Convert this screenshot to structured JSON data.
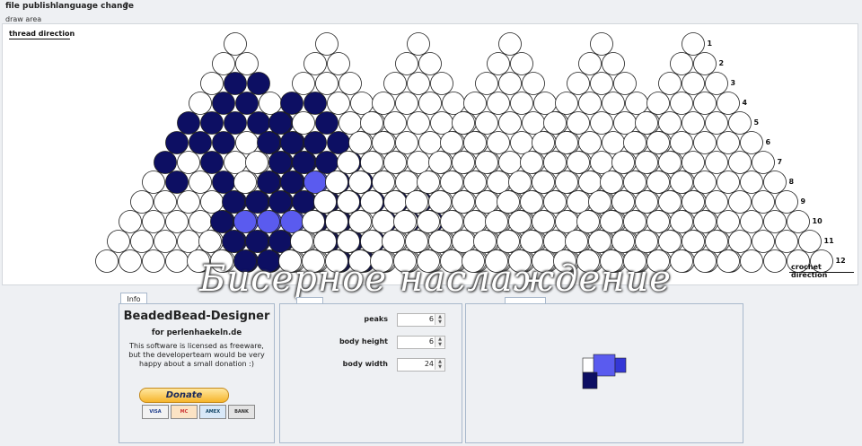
{
  "menu": [
    "file",
    "publish",
    "language change",
    "?"
  ],
  "draw_area": {
    "label": "draw area",
    "thread_direction": "thread direction",
    "crochet_direction": "crochet direction",
    "row_labels": [
      "1",
      "2",
      "3",
      "4",
      "5",
      "6",
      "7",
      "8",
      "9",
      "10",
      "11",
      "12"
    ]
  },
  "colors": {
    "white_bead": "#ffffff",
    "dark_bead": "#0d0f63",
    "light_bead": "#5a5bef",
    "bead_outline": "#202020"
  },
  "watermark": "Бисерное наслаждение",
  "info": {
    "tab": "Info",
    "title": "BeadedBead-Designer",
    "site": "for perlenhaekeln.de",
    "license": "This software is licensed as freeware, but the developerteam would be very happy about a small donation :)",
    "donate": "Donate",
    "cards": [
      "VISA",
      "MC",
      "AMEX",
      "BANK"
    ]
  },
  "params": {
    "peaks": {
      "label": "peaks",
      "value": "6"
    },
    "body_height": {
      "label": "body height",
      "value": "6"
    },
    "body_width": {
      "label": "body width",
      "value": "24"
    }
  }
}
